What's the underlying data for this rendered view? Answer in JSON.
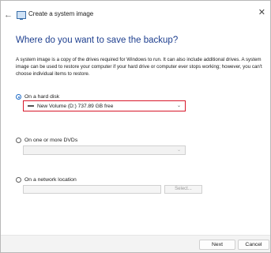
{
  "window": {
    "title": "Create a system image",
    "back_icon": "arrow-left-icon",
    "close_icon": "close-icon"
  },
  "heading": "Where do you want to save the backup?",
  "description": "A system image is a copy of the drives required for Windows to run. It can also include additional drives. A system image can be used to restore your computer if your hard drive or computer ever stops working; however, you can't choose individual items to restore.",
  "options": {
    "hard_disk": {
      "label": "On a hard disk",
      "selected": true,
      "drive_value": "New Volume (D:)  737.89 GB free"
    },
    "dvds": {
      "label": "On one or more DVDs",
      "selected": false,
      "value": ""
    },
    "network": {
      "label": "On a network location",
      "selected": false,
      "value": "",
      "select_button": "Select..."
    }
  },
  "buttons": {
    "next": "Next",
    "cancel": "Cancel"
  },
  "colors": {
    "heading": "#1e3f8f",
    "highlight": "#d7182a",
    "accent": "#1f6cc7"
  }
}
